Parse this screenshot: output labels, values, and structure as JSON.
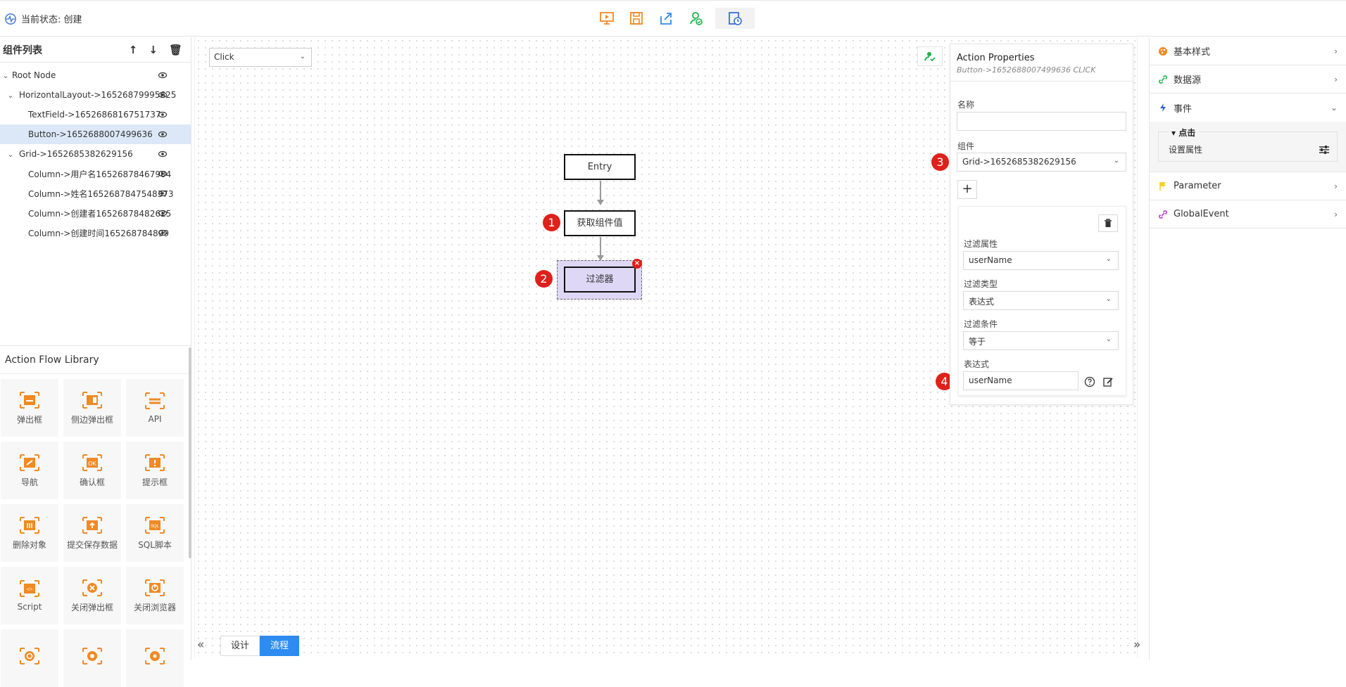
{
  "header": {
    "status_label": "当前状态: 创建"
  },
  "colors": {
    "accent": "#2e8cf0",
    "orange": "#f08a24",
    "badge": "#e0201a",
    "selected_node": "#ded7f5"
  },
  "tree": {
    "title": "组件列表",
    "items": [
      {
        "label": "Root Node"
      },
      {
        "label": "HorizontalLayout->16526879995625"
      },
      {
        "label": "TextField->1652686816751737"
      },
      {
        "label": "Button->1652688007499636"
      },
      {
        "label": "Grid->1652685382629156"
      },
      {
        "label": "Column->用户名16526878467904"
      },
      {
        "label": "Column->姓名1652687847548373"
      },
      {
        "label": "Column->创建者16526878482625"
      },
      {
        "label": "Column->创建时间165268784899"
      }
    ]
  },
  "library": {
    "title": "Action Flow Library",
    "items": [
      {
        "label": "弹出框",
        "icon": "popup-icon"
      },
      {
        "label": "侧边弹出框",
        "icon": "side-popup-icon"
      },
      {
        "label": "API",
        "icon": "api-icon"
      },
      {
        "label": "导航",
        "icon": "navigation-icon"
      },
      {
        "label": "确认框",
        "icon": "confirm-icon"
      },
      {
        "label": "提示框",
        "icon": "alert-icon"
      },
      {
        "label": "删除对象",
        "icon": "delete-object-icon"
      },
      {
        "label": "提交保存数据",
        "icon": "submit-save-icon"
      },
      {
        "label": "SQL脚本",
        "icon": "sql-icon"
      },
      {
        "label": "Script",
        "icon": "script-icon"
      },
      {
        "label": "关闭弹出框",
        "icon": "close-popup-icon"
      },
      {
        "label": "关闭浏览器",
        "icon": "close-browser-icon"
      },
      {
        "label": "",
        "icon": "refresh-icon"
      },
      {
        "label": "",
        "icon": "target-icon"
      },
      {
        "label": "",
        "icon": "gear-icon"
      }
    ]
  },
  "canvas": {
    "event_select": "Click",
    "nodes": {
      "entry": "Entry",
      "get_value": "获取组件值",
      "filter": "过滤器"
    },
    "badges": [
      "1",
      "2",
      "3",
      "4"
    ],
    "tabs": {
      "design": "设计",
      "flow": "流程"
    }
  },
  "props": {
    "title": "Action Properties",
    "subtitle": "Button->1652688007499636 CLICK",
    "name_label": "名称",
    "name_value": "",
    "component_label": "组件",
    "component_value": "Grid->1652685382629156",
    "plus": "+",
    "filter_attr_label": "过滤属性",
    "filter_attr_value": "userName",
    "filter_type_label": "过滤类型",
    "filter_type_value": "表达式",
    "filter_cond_label": "过滤条件",
    "filter_cond_value": "等于",
    "expr_label": "表达式",
    "expr_value": "userName"
  },
  "right_panel": {
    "sections": {
      "basic_style": "基本样式",
      "datasource": "数据源",
      "events": "事件",
      "parameter": "Parameter",
      "global_event": "GlobalEvent"
    },
    "event_group": "点击",
    "event_item": "设置属性"
  }
}
